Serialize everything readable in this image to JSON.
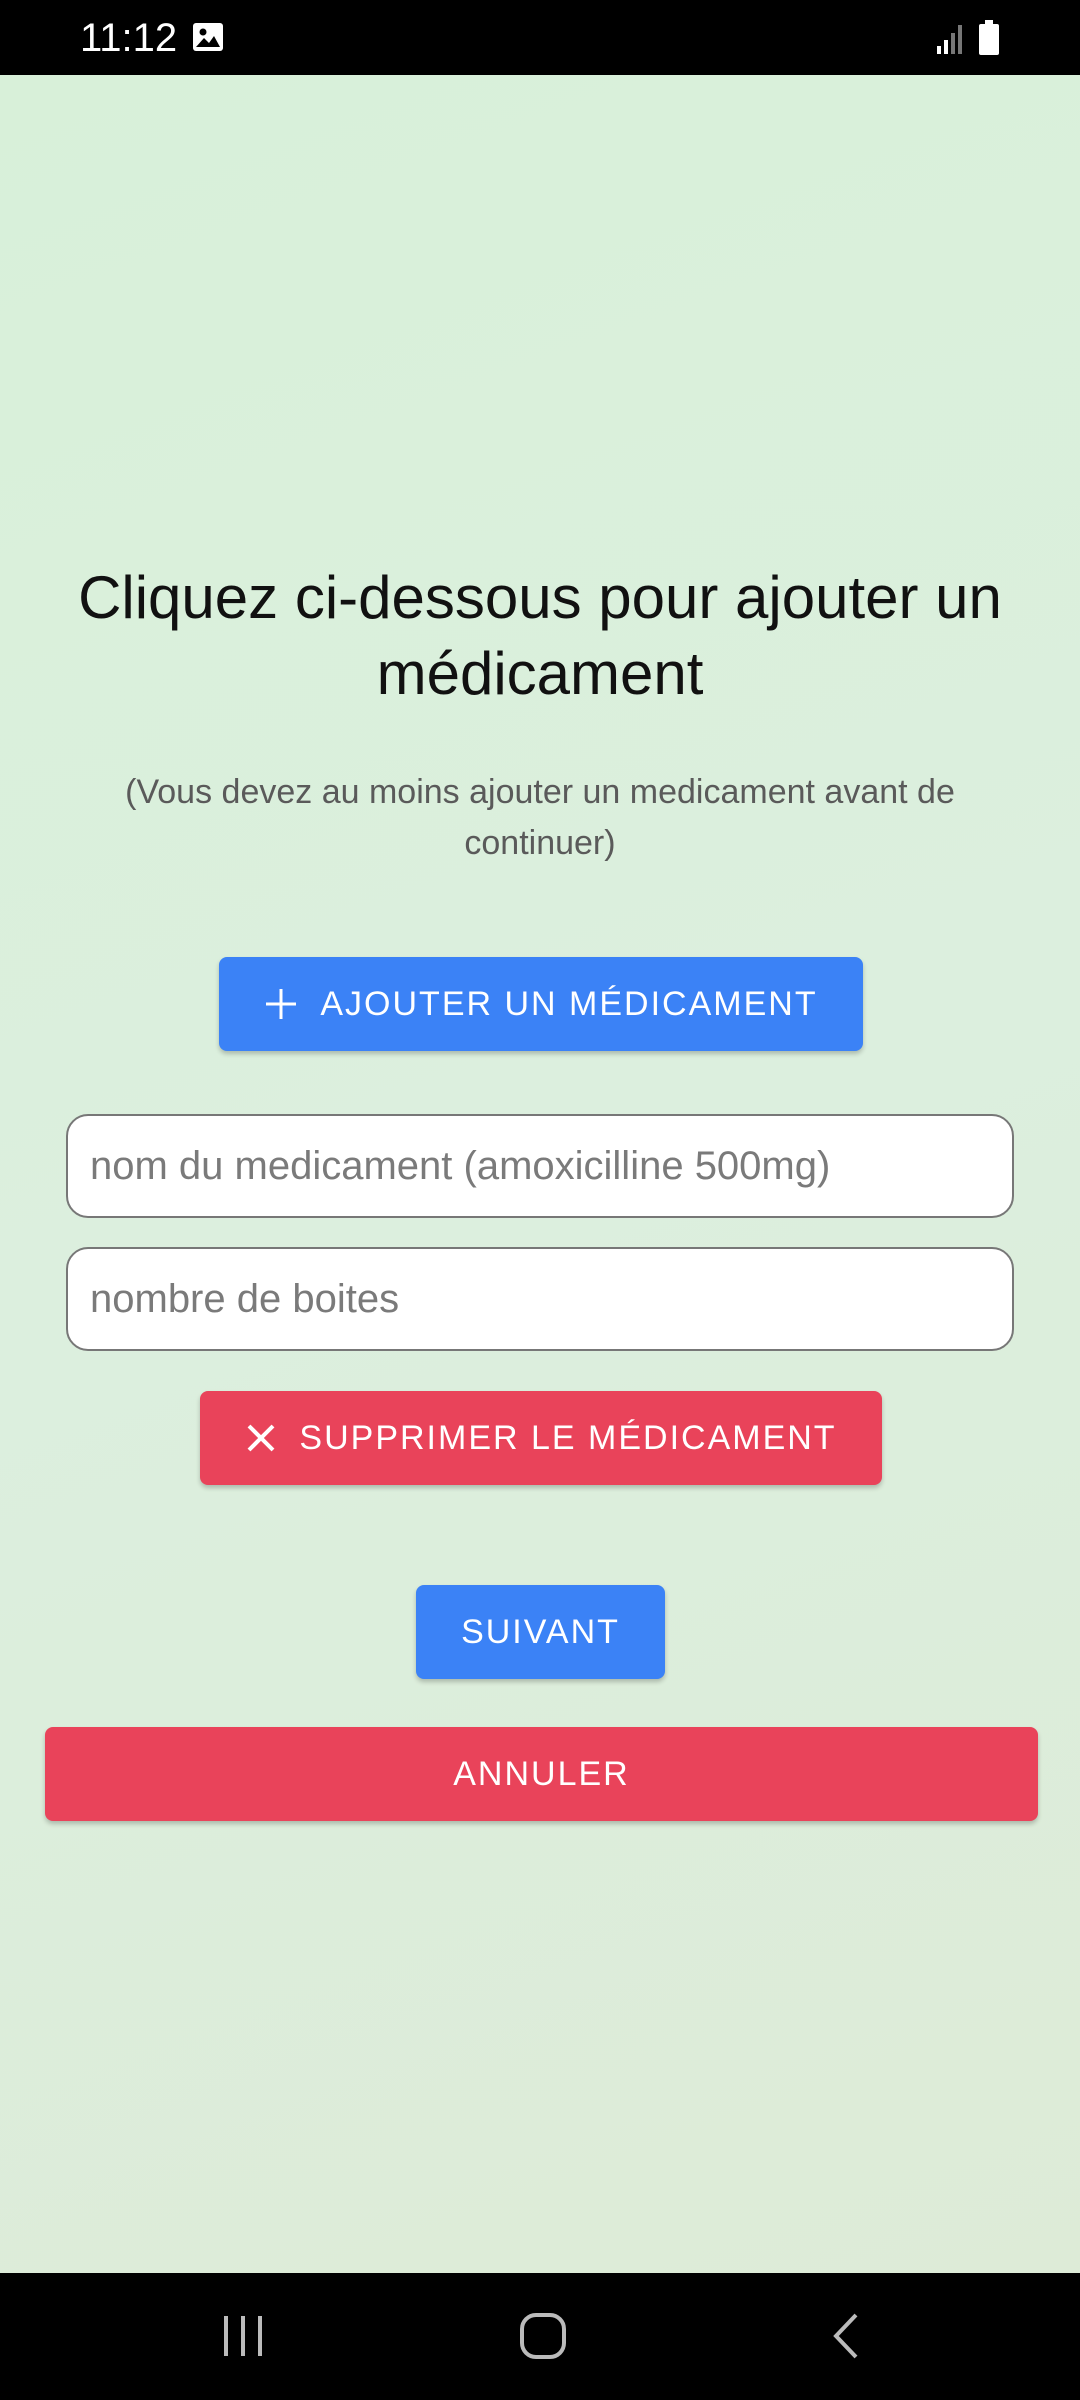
{
  "status_bar": {
    "time": "11:12"
  },
  "main": {
    "heading": "Cliquez ci-dessous pour ajouter un médicament",
    "subtitle": "(Vous devez au moins ajouter un medicament avant de continuer)",
    "add_button_label": "AJOUTER UN MÉDICAMENT",
    "medication_name_placeholder": "nom du medicament (amoxicilline 500mg)",
    "medication_name_value": "",
    "boxes_count_placeholder": "nombre de boites",
    "boxes_count_value": "",
    "remove_button_label": "SUPPRIMER LE MÉDICAMENT",
    "next_button_label": "SUIVANT",
    "cancel_button_label": "ANNULER"
  },
  "icons": {
    "status_image": "image-icon",
    "signal": "signal-icon",
    "battery": "battery-icon",
    "add": "plus-icon",
    "remove": "close-icon",
    "nav_recent": "recent-apps-icon",
    "nav_home": "home-icon",
    "nav_back": "back-icon"
  },
  "colors": {
    "primary_blue": "#3b82f6",
    "danger_red": "#e9435a",
    "background_green": "#d8f0d9"
  }
}
